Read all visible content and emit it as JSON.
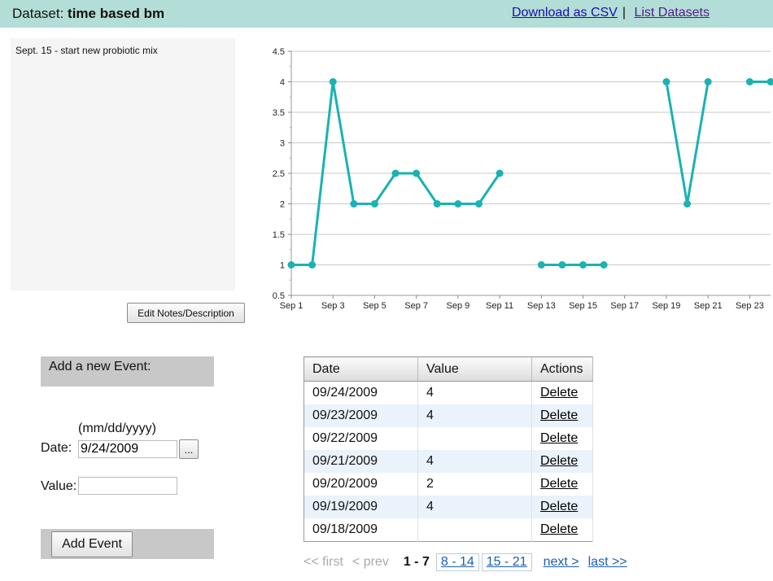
{
  "header": {
    "title_prefix": "Dataset:",
    "title_name": "time based bm",
    "download_label": "Download as CSV",
    "separator": "|",
    "list_label": "List Datasets"
  },
  "notes": {
    "text": "Sept. 15 - start new probiotic mix",
    "edit_label": "Edit Notes/Description"
  },
  "colors": {
    "header_bg": "#b3ded7",
    "series": "#1ab2b2",
    "panel_bg": "#c8c8c8",
    "row_alt": "#eaf2fb"
  },
  "chart_data": {
    "type": "line",
    "x_ticks": [
      "Sep 1",
      "Sep 3",
      "Sep 5",
      "Sep 7",
      "Sep 9",
      "Sep 11",
      "Sep 13",
      "Sep 15",
      "Sep 17",
      "Sep 19",
      "Sep 21",
      "Sep 23"
    ],
    "y_ticks": [
      "0.5",
      "1",
      "1.5",
      "2",
      "2.5",
      "3",
      "3.5",
      "4",
      "4.5"
    ],
    "ylim": [
      0.5,
      4.5
    ],
    "xlim": [
      1,
      24
    ],
    "grid": true,
    "series": [
      {
        "x": [
          1,
          2,
          3,
          4,
          5,
          6,
          7,
          8,
          9,
          10,
          11,
          12,
          13,
          14,
          15,
          16,
          17,
          18,
          19,
          20,
          21,
          22,
          23,
          24
        ],
        "y": [
          1,
          1,
          4,
          2,
          2,
          2.5,
          2.5,
          2,
          2,
          2,
          2.5,
          null,
          1,
          1,
          1,
          1,
          null,
          null,
          4,
          2,
          4,
          null,
          4,
          4
        ]
      }
    ]
  },
  "event_form": {
    "heading": "Add a new Event:",
    "date_format": "(mm/dd/yyyy)",
    "date_label": "Date:",
    "date_value": "9/24/2009",
    "picker_label": "...",
    "value_label": "Value:",
    "value_value": "",
    "submit_label": "Add Event"
  },
  "table": {
    "headers": [
      "Date",
      "Value",
      "Actions"
    ],
    "rows": [
      {
        "date": "09/24/2009",
        "value": "4",
        "action": "Delete"
      },
      {
        "date": "09/23/2009",
        "value": "4",
        "action": "Delete"
      },
      {
        "date": "09/22/2009",
        "value": "",
        "action": "Delete"
      },
      {
        "date": "09/21/2009",
        "value": "4",
        "action": "Delete"
      },
      {
        "date": "09/20/2009",
        "value": "2",
        "action": "Delete"
      },
      {
        "date": "09/19/2009",
        "value": "4",
        "action": "Delete"
      },
      {
        "date": "09/18/2009",
        "value": "",
        "action": "Delete"
      }
    ]
  },
  "pager": {
    "first": "<< first",
    "prev": "< prev",
    "current": "1 - 7",
    "pages": [
      "8 - 14",
      "15 - 21"
    ],
    "next": "next >",
    "last": "last >>"
  }
}
